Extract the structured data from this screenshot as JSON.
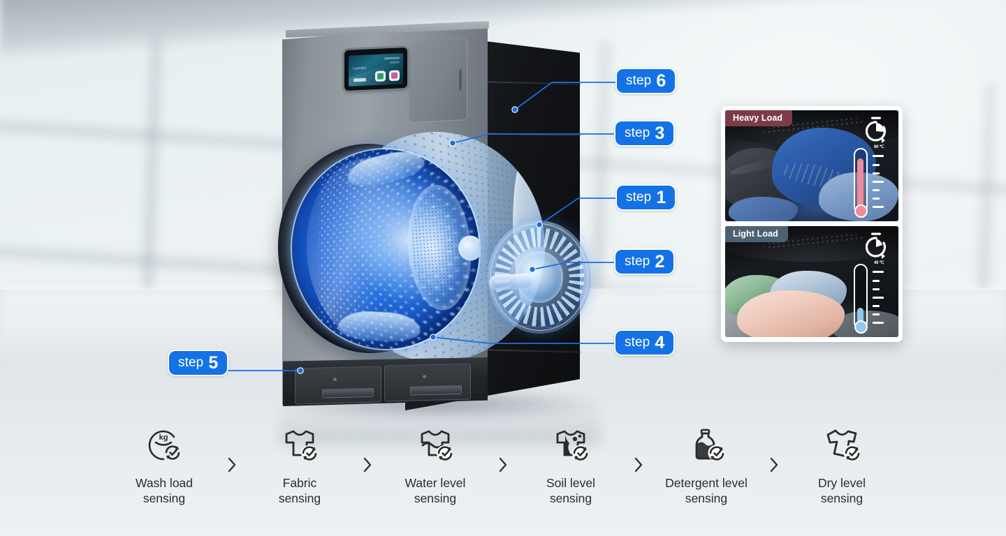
{
  "scene": {
    "product": "front-load washing machine cutaway",
    "display_text": "Laundry",
    "display_button": ""
  },
  "steps": [
    {
      "id": "step-1",
      "word": "step",
      "number": "1"
    },
    {
      "id": "step-2",
      "word": "step",
      "number": "2"
    },
    {
      "id": "step-3",
      "word": "step",
      "number": "3"
    },
    {
      "id": "step-4",
      "word": "step",
      "number": "4"
    },
    {
      "id": "step-5",
      "word": "step",
      "number": "5"
    },
    {
      "id": "step-6",
      "word": "step",
      "number": "6"
    }
  ],
  "load_panel": {
    "cards": [
      {
        "badge": "Heavy Load",
        "badge_color": "#7d3b47",
        "temperature_label": "60 ℃",
        "thermometer_level": "high",
        "thermometer_color": "#ef8a9b"
      },
      {
        "badge": "Light Load",
        "badge_color": "#4e6173",
        "temperature_label": "40 ℃",
        "thermometer_level": "low",
        "thermometer_color": "#8fc9ec"
      }
    ]
  },
  "sensing_steps": [
    {
      "icon": "wash-load-sensing-icon",
      "label": "Wash load\nsensing"
    },
    {
      "icon": "fabric-sensing-icon",
      "label": "Fabric\nsensing"
    },
    {
      "icon": "water-level-sensing-icon",
      "label": "Water level\nsensing"
    },
    {
      "icon": "soil-level-sensing-icon",
      "label": "Soil level\nsensing"
    },
    {
      "icon": "detergent-level-sensing-icon",
      "label": "Detergent level\nsensing"
    },
    {
      "icon": "dry-level-sensing-icon",
      "label": "Dry level\nsensing"
    }
  ],
  "separator": "›",
  "colors": {
    "badge_blue": "#1472e6",
    "badge_border": "#ffffff",
    "leader_line": "#1c6ee0",
    "drum_blue": "#1b62d6",
    "label_text": "#2b2b2b"
  }
}
